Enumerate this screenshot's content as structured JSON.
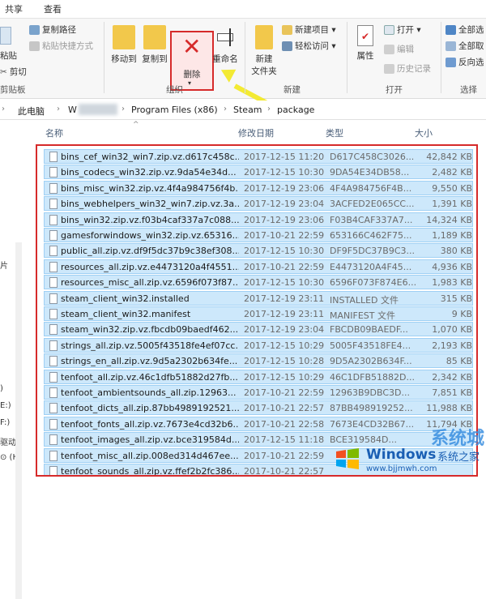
{
  "tabs": [
    "共享",
    "查看"
  ],
  "ribbon": {
    "clipboard_items": [
      "复制路径",
      "粘贴快捷方式"
    ],
    "paste_label": "粘贴",
    "cut_label": "剪切",
    "clipboard_group": "剪贴板",
    "move_to": "移动到",
    "copy_to": "复制到",
    "delete": "删除",
    "rename": "重命名",
    "organize_group": "组织",
    "new_folder_line1": "新建",
    "new_folder_line2": "文件夹",
    "new_item": "新建项目 ▾",
    "easy_access": "轻松访问 ▾",
    "new_group": "新建",
    "properties": "属性",
    "open": "打开 ▾",
    "edit": "编辑",
    "history": "历史记录",
    "open_group": "打开",
    "select_all": "全部选",
    "select_none": "全部取",
    "invert": "反向选",
    "select_group": "选择"
  },
  "address": {
    "this_pc": "此电脑",
    "drive": "W",
    "seg1": "Program Files (x86)",
    "seg2": "Steam",
    "seg3": "package"
  },
  "leftnav": [
    "片",
    ")",
    "E:)",
    "F:)",
    "驱动",
    "⊙ (H:"
  ],
  "columns": {
    "name": "名称",
    "date": "修改日期",
    "type": "类型",
    "size": "大小"
  },
  "files": [
    {
      "name": "bins_cef_win32_win7.zip.vz.d617c458c...",
      "date": "2017-12-15 11:20",
      "type": "D617C458C3026...",
      "size": "42,842 KB"
    },
    {
      "name": "bins_codecs_win32.zip.vz.9da54e34d...",
      "date": "2017-12-15 10:30",
      "type": "9DA54E34DB58...",
      "size": "2,482 KB"
    },
    {
      "name": "bins_misc_win32.zip.vz.4f4a984756f4b...",
      "date": "2017-12-19 23:06",
      "type": "4F4A984756F4B...",
      "size": "9,550 KB"
    },
    {
      "name": "bins_webhelpers_win32_win7.zip.vz.3a...",
      "date": "2017-12-19 23:04",
      "type": "3ACFED2E065CC...",
      "size": "1,391 KB"
    },
    {
      "name": "bins_win32.zip.vz.f03b4caf337a7c088...",
      "date": "2017-12-19 23:06",
      "type": "F03B4CAF337A7...",
      "size": "14,324 KB"
    },
    {
      "name": "gamesforwindows_win32.zip.vz.65316...",
      "date": "2017-10-21 22:59",
      "type": "653166C462F75...",
      "size": "1,189 KB"
    },
    {
      "name": "public_all.zip.vz.df9f5dc37b9c38ef308...",
      "date": "2017-12-15 10:30",
      "type": "DF9F5DC37B9C3...",
      "size": "380 KB"
    },
    {
      "name": "resources_all.zip.vz.e4473120a4f4551...",
      "date": "2017-10-21 22:59",
      "type": "E4473120A4F45...",
      "size": "4,936 KB"
    },
    {
      "name": "resources_misc_all.zip.vz.6596f073f87...",
      "date": "2017-12-15 10:30",
      "type": "6596F073F874E6...",
      "size": "1,983 KB"
    },
    {
      "name": "steam_client_win32.installed",
      "date": "2017-12-19 23:11",
      "type": "INSTALLED 文件",
      "size": "315 KB"
    },
    {
      "name": "steam_client_win32.manifest",
      "date": "2017-12-19 23:11",
      "type": "MANIFEST 文件",
      "size": "9 KB"
    },
    {
      "name": "steam_win32.zip.vz.fbcdb09baedf462...",
      "date": "2017-12-19 23:04",
      "type": "FBCDB09BAEDF...",
      "size": "1,070 KB"
    },
    {
      "name": "strings_all.zip.vz.5005f43518fe4ef07cc...",
      "date": "2017-12-15 10:29",
      "type": "5005F43518FE4...",
      "size": "2,193 KB"
    },
    {
      "name": "strings_en_all.zip.vz.9d5a2302b634fe...",
      "date": "2017-12-15 10:28",
      "type": "9D5A2302B634F...",
      "size": "85 KB"
    },
    {
      "name": "tenfoot_all.zip.vz.46c1dfb51882d27fb...",
      "date": "2017-12-15 10:29",
      "type": "46C1DFB51882D...",
      "size": "2,342 KB"
    },
    {
      "name": "tenfoot_ambientsounds_all.zip.12963...",
      "date": "2017-10-21 22:59",
      "type": "12963B9DBC3D...",
      "size": "7,851 KB"
    },
    {
      "name": "tenfoot_dicts_all.zip.87bb4989192521...",
      "date": "2017-10-21 22:57",
      "type": "87BB498919252...",
      "size": "11,988 KB"
    },
    {
      "name": "tenfoot_fonts_all.zip.vz.7673e4cd32b6...",
      "date": "2017-10-21 22:58",
      "type": "7673E4CD32B67...",
      "size": "11,794 KB"
    },
    {
      "name": "tenfoot_images_all.zip.vz.bce319584d...",
      "date": "2017-12-15 11:18",
      "type": "BCE319584D...",
      "size": ""
    },
    {
      "name": "tenfoot_misc_all.zip.008ed314d467ee...",
      "date": "2017-10-21 22:59",
      "type": "",
      "size": ""
    },
    {
      "name": "tenfoot_sounds_all.zip.vz.ffef2b2fc386...",
      "date": "2017-10-21 22:57",
      "type": "",
      "size": ""
    }
  ],
  "watermark": {
    "title": "Windows",
    "cn": "系统之家",
    "url": "www.bjjmwh.com",
    "big": "系统城"
  }
}
